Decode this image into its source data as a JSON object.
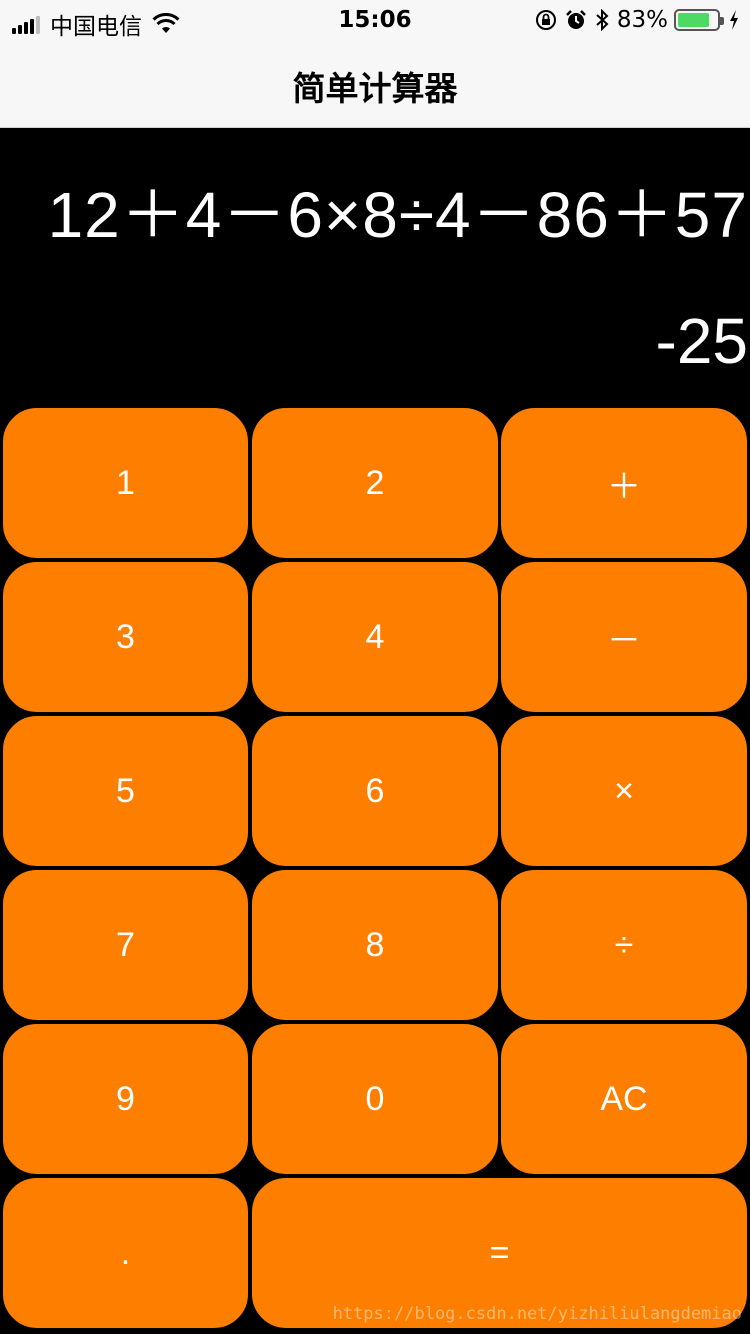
{
  "status_bar": {
    "carrier": "中国电信",
    "time": "15:06",
    "battery_percent_text": "83%",
    "battery_level": 0.83,
    "icons": [
      "signal-icon",
      "wifi-icon",
      "orientation-lock-icon",
      "alarm-icon",
      "bluetooth-icon",
      "battery-icon",
      "charging-icon"
    ]
  },
  "nav": {
    "title": "简单计算器"
  },
  "display": {
    "expression": "12＋4－6×8÷4－86＋57",
    "result": "-25"
  },
  "keys": {
    "k1": "1",
    "k2": "2",
    "plus": "＋",
    "k3": "3",
    "k4": "4",
    "minus": "－",
    "k5": "5",
    "k6": "6",
    "multiply": "×",
    "k7": "7",
    "k8": "8",
    "divide": "÷",
    "k9": "9",
    "k0": "0",
    "clear": "AC",
    "dot": ".",
    "equals": "="
  },
  "watermark": "https://blog.csdn.net/yizhiliulangdemiao",
  "colors": {
    "key_orange": "#fe7f00",
    "background": "#000000",
    "battery_green": "#4cd964"
  }
}
